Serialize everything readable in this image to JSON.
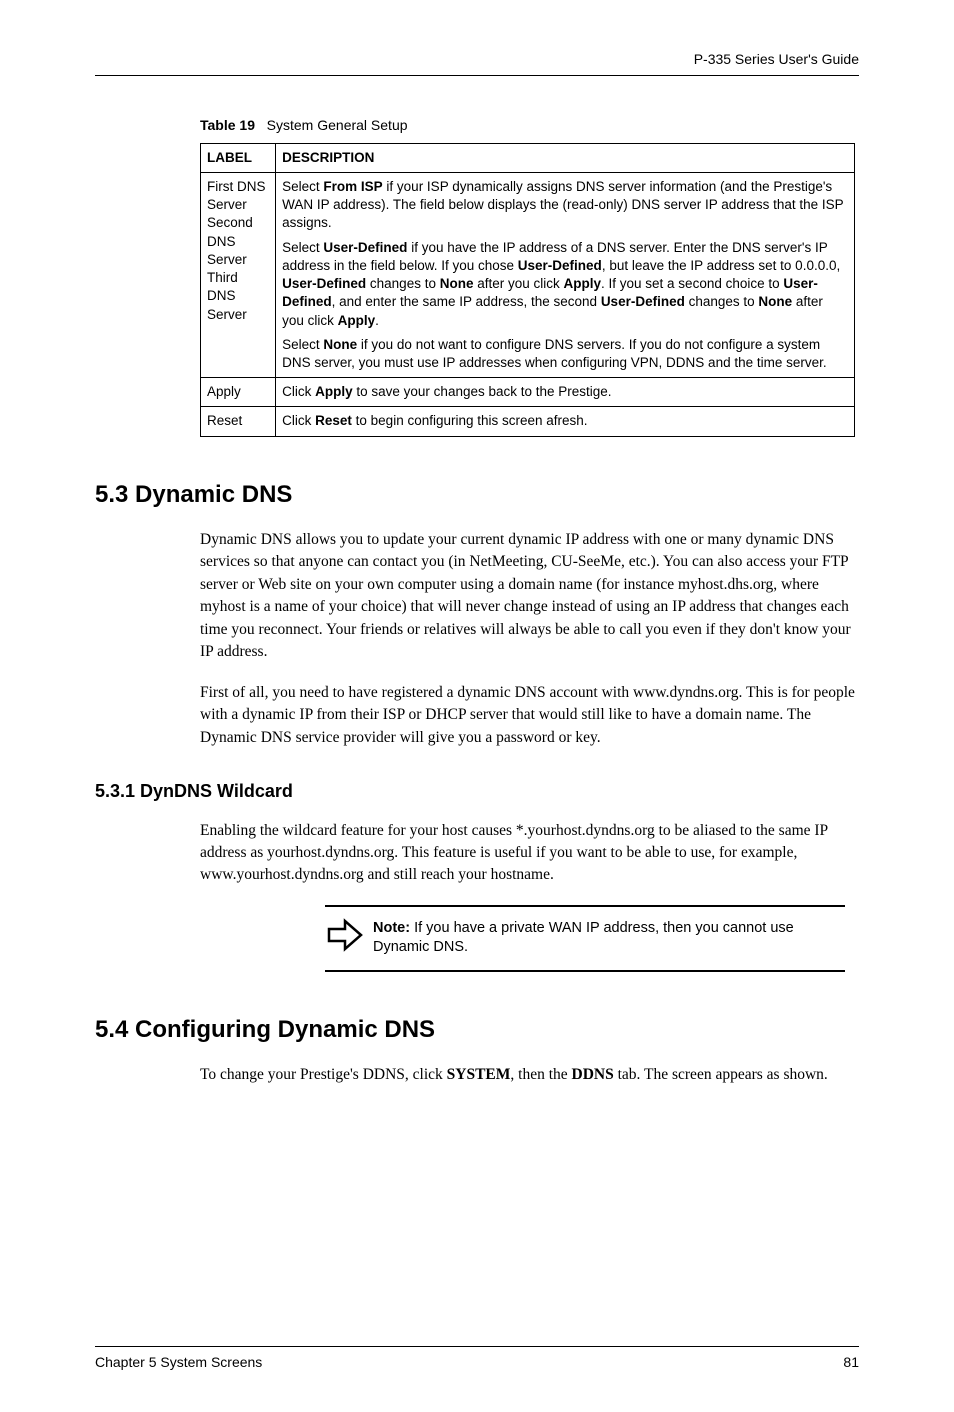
{
  "header": {
    "guide_title": "P-335 Series User's Guide"
  },
  "table": {
    "caption_prefix": "Table 19",
    "caption": "System General Setup",
    "headers": {
      "label": "LABEL",
      "description": "DESCRIPTION"
    },
    "rows": {
      "dns": {
        "label_line1": "First DNS Server",
        "label_line2": "Second DNS Server",
        "label_line3": "Third DNS Server",
        "p1_a": "Select ",
        "p1_b": "From ISP",
        "p1_c": " if your ISP dynamically assigns DNS server information (and the Prestige's WAN IP address). The field below displays the (read-only) DNS server IP address that the ISP assigns.",
        "p2_a": "Select ",
        "p2_b": "User-Defined",
        "p2_c": " if you have the IP address of a DNS server. Enter the DNS server's IP address in the field below. If you chose ",
        "p2_d": "User-Defined",
        "p2_e": ", but leave the IP address set to 0.0.0.0, ",
        "p2_f": "User-Defined",
        "p2_g": " changes to ",
        "p2_h": "None",
        "p2_i": " after you click ",
        "p2_j": "Apply",
        "p2_k": ". If you set a second choice to ",
        "p2_l": "User-Defined",
        "p2_m": ", and enter the same IP address, the second ",
        "p2_n": "User-Defined",
        "p2_o": " changes to ",
        "p2_p": "None",
        "p2_q": " after you click ",
        "p2_r": "Apply",
        "p2_s": ".",
        "p3_a": "Select ",
        "p3_b": "None",
        "p3_c": " if you do not want to configure DNS servers. If you do not configure a system DNS server, you must use IP addresses when configuring VPN, DDNS and the time server."
      },
      "apply": {
        "label": "Apply",
        "d_a": "Click ",
        "d_b": "Apply",
        "d_c": " to save your changes back to the Prestige."
      },
      "reset": {
        "label": "Reset",
        "d_a": "Click ",
        "d_b": "Reset",
        "d_c": " to begin configuring this screen afresh."
      }
    }
  },
  "sections": {
    "s53": {
      "title": "5.3  Dynamic DNS",
      "p1": "Dynamic DNS allows you to update your current dynamic IP address with one or many dynamic DNS services so that anyone can contact you (in NetMeeting, CU-SeeMe, etc.). You can also access your FTP server or Web site on your own computer using a domain name (for instance myhost.dhs.org, where myhost is a name of your choice) that will never change instead of using an IP address that changes each time you reconnect. Your friends or relatives will always be able to call you even if they don't know your IP address.",
      "p2": "First of all, you need to have registered a dynamic DNS account with www.dyndns.org. This is for people with a dynamic IP from their ISP or DHCP server that would still like to have a domain name. The Dynamic DNS service provider will give you a password or key."
    },
    "s531": {
      "title": "5.3.1  DynDNS Wildcard",
      "p1": "Enabling the wildcard feature for your host causes *.yourhost.dyndns.org to be aliased to the same IP address as yourhost.dyndns.org. This feature is useful if you want to be able to use, for example, www.yourhost.dyndns.org and still reach your hostname."
    },
    "note": {
      "prefix": "Note:",
      "text": " If you have a private WAN IP address, then you cannot use Dynamic DNS."
    },
    "s54": {
      "title": "5.4  Configuring Dynamic DNS",
      "p1_a": "To change your Prestige's DDNS, click ",
      "p1_b": "SYSTEM",
      "p1_c": ", then the ",
      "p1_d": "DDNS",
      "p1_e": " tab. The screen appears as shown."
    }
  },
  "footer": {
    "chapter": "Chapter 5 System Screens",
    "page": "81"
  }
}
